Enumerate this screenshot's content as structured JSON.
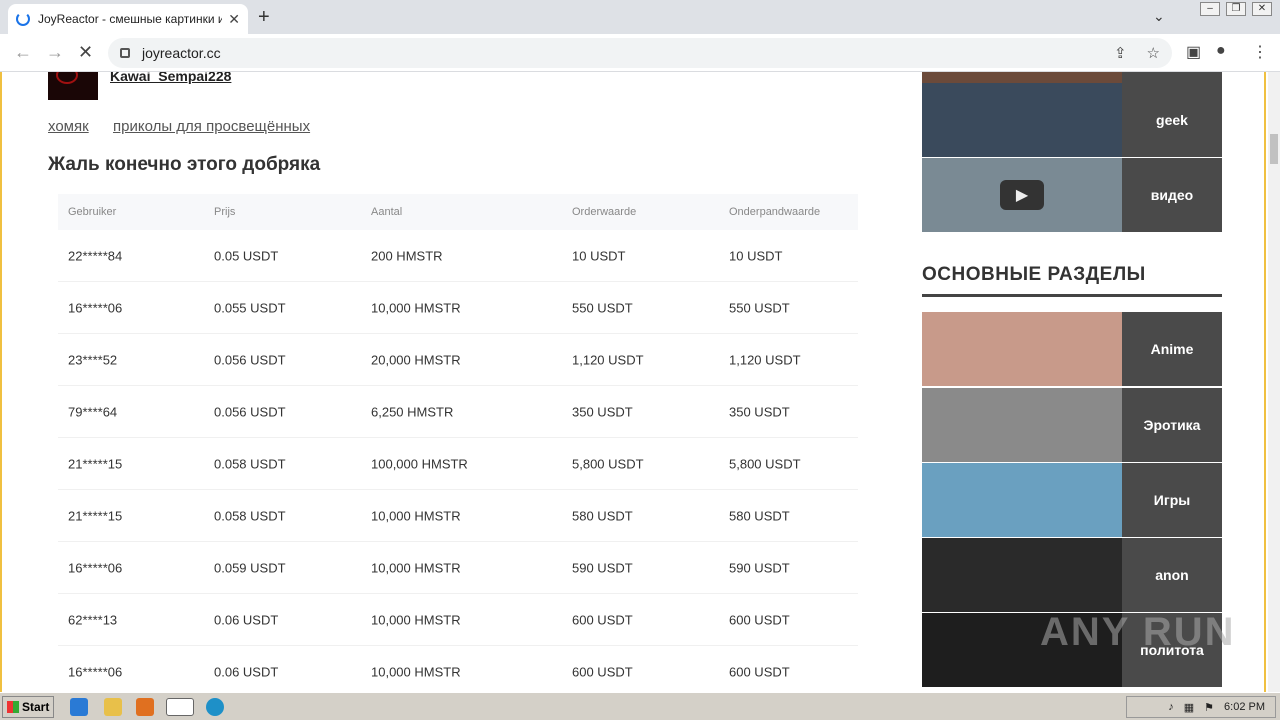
{
  "browser": {
    "tab_title": "JoyReactor - смешные картинки и",
    "url": "joyreactor.cc"
  },
  "post": {
    "author": "Kawai_Sempai228",
    "tags": [
      "хомяк",
      "приколы для просвещённых"
    ],
    "title": "Жаль конечно этого добряка"
  },
  "table": {
    "headers": [
      "Gebruiker",
      "Prijs",
      "Aantal",
      "Orderwaarde",
      "Onderpandwaarde"
    ],
    "rows": [
      [
        "22*****84",
        "0.05 USDT",
        "200 HMSTR",
        "10 USDT",
        "10 USDT"
      ],
      [
        "16*****06",
        "0.055 USDT",
        "10,000 HMSTR",
        "550 USDT",
        "550 USDT"
      ],
      [
        "23****52",
        "0.056 USDT",
        "20,000 HMSTR",
        "1,120 USDT",
        "1,120 USDT"
      ],
      [
        "79****64",
        "0.056 USDT",
        "6,250 HMSTR",
        "350 USDT",
        "350 USDT"
      ],
      [
        "21*****15",
        "0.058 USDT",
        "100,000 HMSTR",
        "5,800 USDT",
        "5,800 USDT"
      ],
      [
        "21*****15",
        "0.058 USDT",
        "10,000 HMSTR",
        "580 USDT",
        "580 USDT"
      ],
      [
        "16*****06",
        "0.059 USDT",
        "10,000 HMSTR",
        "590 USDT",
        "590 USDT"
      ],
      [
        "62****13",
        "0.06 USDT",
        "10,000 HMSTR",
        "600 USDT",
        "600 USDT"
      ],
      [
        "16*****06",
        "0.06 USDT",
        "10,000 HMSTR",
        "600 USDT",
        "600 USDT"
      ]
    ]
  },
  "sidebar": {
    "top_items": [
      {
        "label": "geek",
        "color": "#3a4a5c"
      },
      {
        "label": "видео",
        "color": "#7a8a94"
      }
    ],
    "section_title": "ОСНОВНЫЕ РАЗДЕЛЫ",
    "items": [
      {
        "label": "Anime",
        "color": "#c89a8a"
      },
      {
        "label": "Эротика",
        "color": "#8a8a8a"
      },
      {
        "label": "Игры",
        "color": "#6aa0c0"
      },
      {
        "label": "anon",
        "color": "#2a2a2a"
      },
      {
        "label": "политота",
        "color": "#1e1e1e"
      }
    ]
  },
  "watermark": "ANY RUN",
  "taskbar": {
    "start_label": "Start",
    "time": "6:02 PM"
  }
}
